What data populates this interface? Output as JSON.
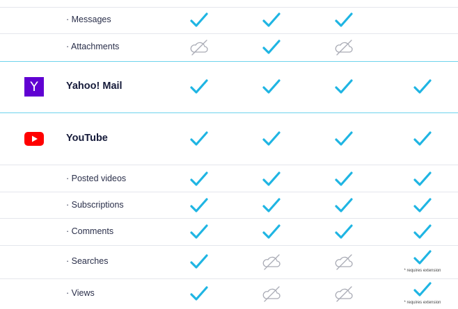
{
  "colors": {
    "check": "#1fb5e3",
    "unavailable": "#a9abb5",
    "divider_accent": "#6dd3ec",
    "divider": "#e4e6ec",
    "yahoo_brand": "#6001d2",
    "youtube_brand": "#ff0000"
  },
  "status_icons": {
    "supported": "check-icon",
    "not_supported": "cloud-off-icon"
  },
  "rows": [
    {
      "label": "· Messages",
      "type": "sub",
      "cells": [
        "supported",
        "supported",
        "supported",
        "empty"
      ],
      "note": ""
    },
    {
      "label": "· Attachments",
      "type": "sub",
      "cells": [
        "not_supported",
        "supported",
        "not_supported",
        "empty"
      ],
      "note": ""
    },
    {
      "label": "Yahoo! Mail",
      "type": "main",
      "logo": "yahoo-logo",
      "logo_text": "Y",
      "cells": [
        "supported",
        "supported",
        "supported",
        "supported"
      ],
      "note": ""
    },
    {
      "label": "YouTube",
      "type": "main",
      "logo": "youtube-logo",
      "cells": [
        "supported",
        "supported",
        "supported",
        "supported"
      ],
      "note": ""
    },
    {
      "label": "· Posted videos",
      "type": "sub",
      "cells": [
        "supported",
        "supported",
        "supported",
        "supported"
      ],
      "note": ""
    },
    {
      "label": "· Subscriptions",
      "type": "sub",
      "cells": [
        "supported",
        "supported",
        "supported",
        "supported"
      ],
      "note": ""
    },
    {
      "label": "· Comments",
      "type": "sub",
      "cells": [
        "supported",
        "supported",
        "supported",
        "supported"
      ],
      "note": ""
    },
    {
      "label": "· Searches",
      "type": "sub",
      "cells": [
        "supported",
        "not_supported",
        "not_supported",
        "supported"
      ],
      "note": "* requires extension"
    },
    {
      "label": "· Views",
      "type": "sub",
      "cells": [
        "supported",
        "not_supported",
        "not_supported",
        "supported"
      ],
      "note": "* requires extension"
    }
  ]
}
